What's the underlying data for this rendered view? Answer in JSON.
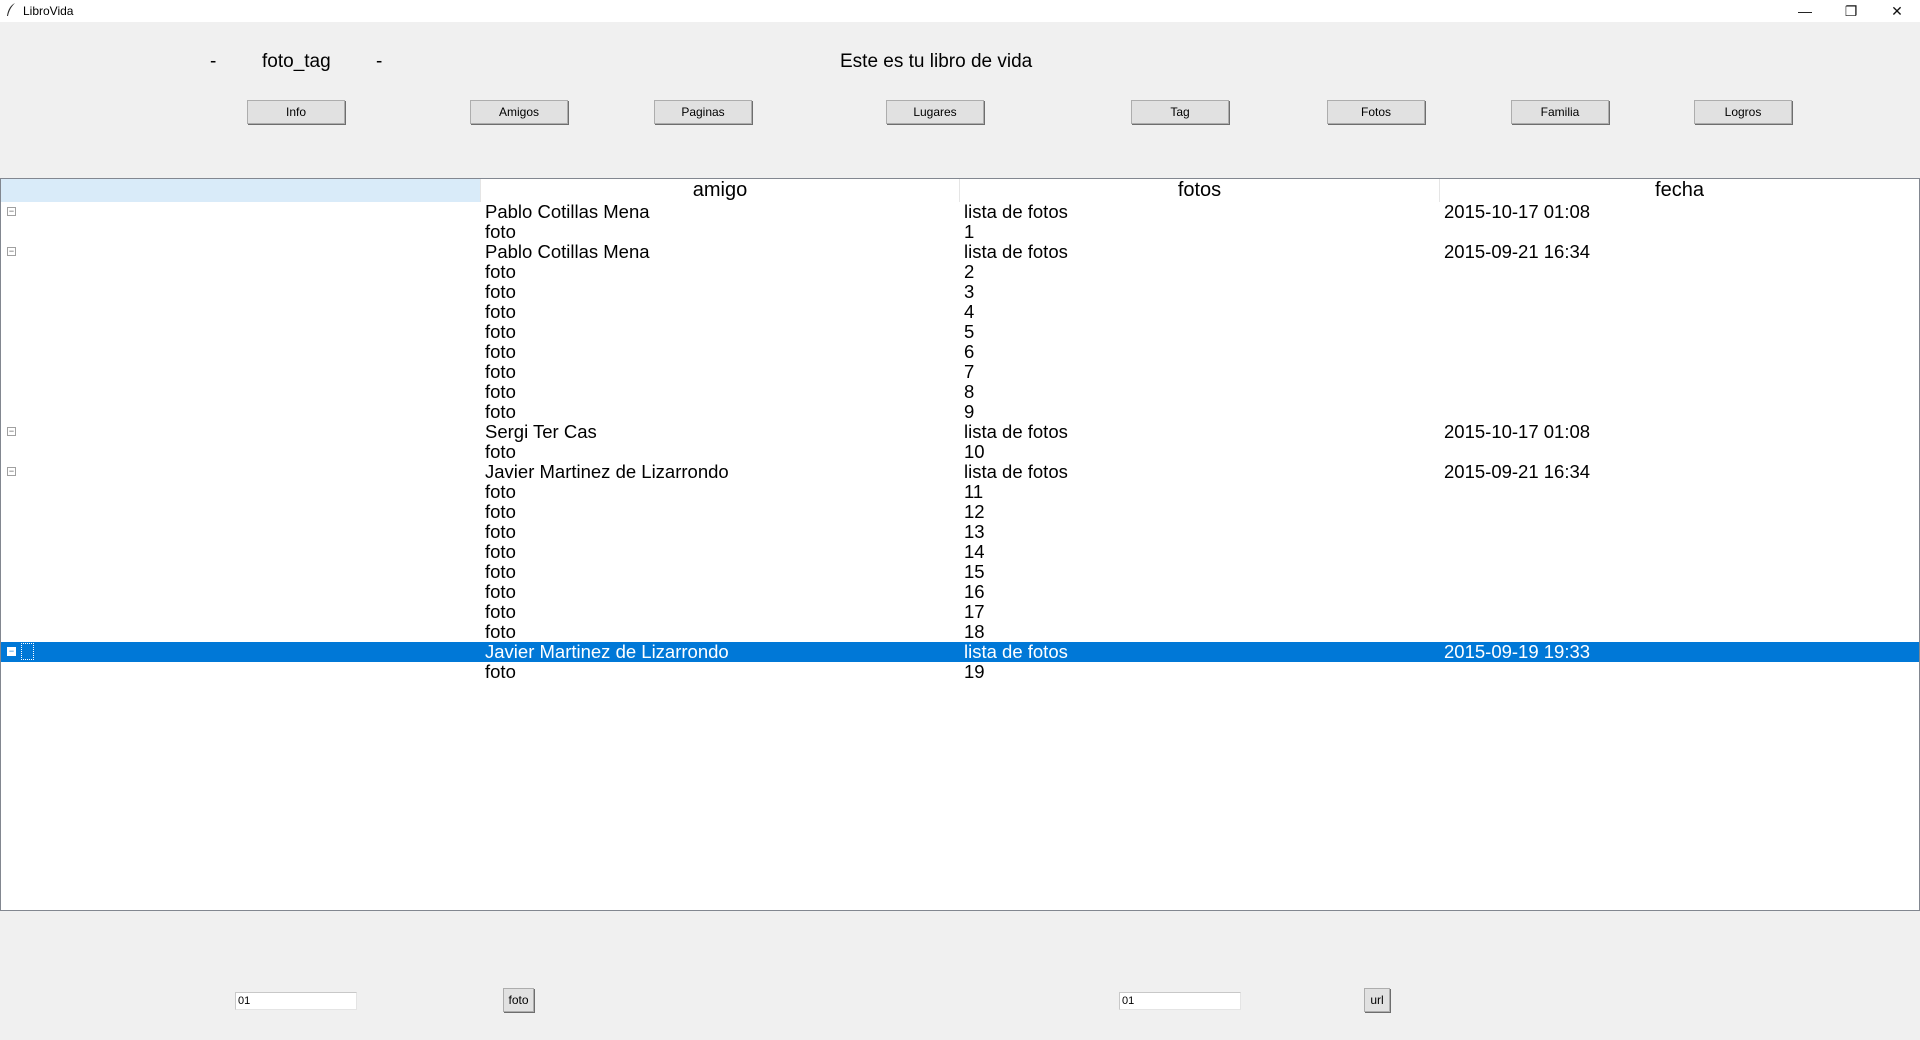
{
  "window": {
    "title": "LibroVida",
    "minimize": "—",
    "maximize": "❐",
    "close": "✕"
  },
  "header": {
    "left_dash": "-",
    "user": "foto_tag",
    "right_dash": "-",
    "title": "Este es tu libro de vida"
  },
  "nav": {
    "buttons": [
      "Info",
      "Amigos",
      "Paginas",
      "Lugares",
      "Tag",
      "Fotos",
      "Familia",
      "Logros"
    ]
  },
  "tree": {
    "columns": [
      "",
      "amigo",
      "fotos",
      "fecha"
    ],
    "rows": [
      {
        "expander": "−",
        "amigo": "Pablo Cotillas Mena",
        "fotos": "lista de fotos",
        "fecha": "2015-10-17 01:08"
      },
      {
        "amigo": "foto",
        "fotos": "1",
        "fecha": ""
      },
      {
        "expander": "−",
        "amigo": "Pablo Cotillas Mena",
        "fotos": "lista de fotos",
        "fecha": "2015-09-21 16:34"
      },
      {
        "amigo": "foto",
        "fotos": "2",
        "fecha": ""
      },
      {
        "amigo": "foto",
        "fotos": "3",
        "fecha": ""
      },
      {
        "amigo": "foto",
        "fotos": "4",
        "fecha": ""
      },
      {
        "amigo": "foto",
        "fotos": "5",
        "fecha": ""
      },
      {
        "amigo": "foto",
        "fotos": "6",
        "fecha": ""
      },
      {
        "amigo": "foto",
        "fotos": "7",
        "fecha": ""
      },
      {
        "amigo": "foto",
        "fotos": "8",
        "fecha": ""
      },
      {
        "amigo": "foto",
        "fotos": "9",
        "fecha": ""
      },
      {
        "expander": "−",
        "amigo": "Sergi Ter Cas",
        "fotos": "lista de fotos",
        "fecha": "2015-10-17 01:08"
      },
      {
        "amigo": "foto",
        "fotos": "10",
        "fecha": ""
      },
      {
        "expander": "−",
        "amigo": "Javier Martinez de Lizarrondo",
        "fotos": "lista de fotos",
        "fecha": "2015-09-21 16:34"
      },
      {
        "amigo": "foto",
        "fotos": "11",
        "fecha": ""
      },
      {
        "amigo": "foto",
        "fotos": "12",
        "fecha": ""
      },
      {
        "amigo": "foto",
        "fotos": "13",
        "fecha": ""
      },
      {
        "amigo": "foto",
        "fotos": "14",
        "fecha": ""
      },
      {
        "amigo": "foto",
        "fotos": "15",
        "fecha": ""
      },
      {
        "amigo": "foto",
        "fotos": "16",
        "fecha": ""
      },
      {
        "amigo": "foto",
        "fotos": "17",
        "fecha": ""
      },
      {
        "amigo": "foto",
        "fotos": "18",
        "fecha": ""
      },
      {
        "expander": "−",
        "amigo": "Javier Martinez de Lizarrondo",
        "fotos": "lista de fotos",
        "fecha": "2015-09-19 19:33",
        "selected": true
      },
      {
        "amigo": "foto",
        "fotos": "19",
        "fecha": ""
      }
    ]
  },
  "bottom": {
    "foto_id_value": "01",
    "foto_button": "foto",
    "url_id_value": "01",
    "url_button": "url"
  },
  "colors": {
    "selection": "#0078d7",
    "header_tree_cell": "#d9ebf9",
    "window_bg": "#f0f0f0"
  }
}
